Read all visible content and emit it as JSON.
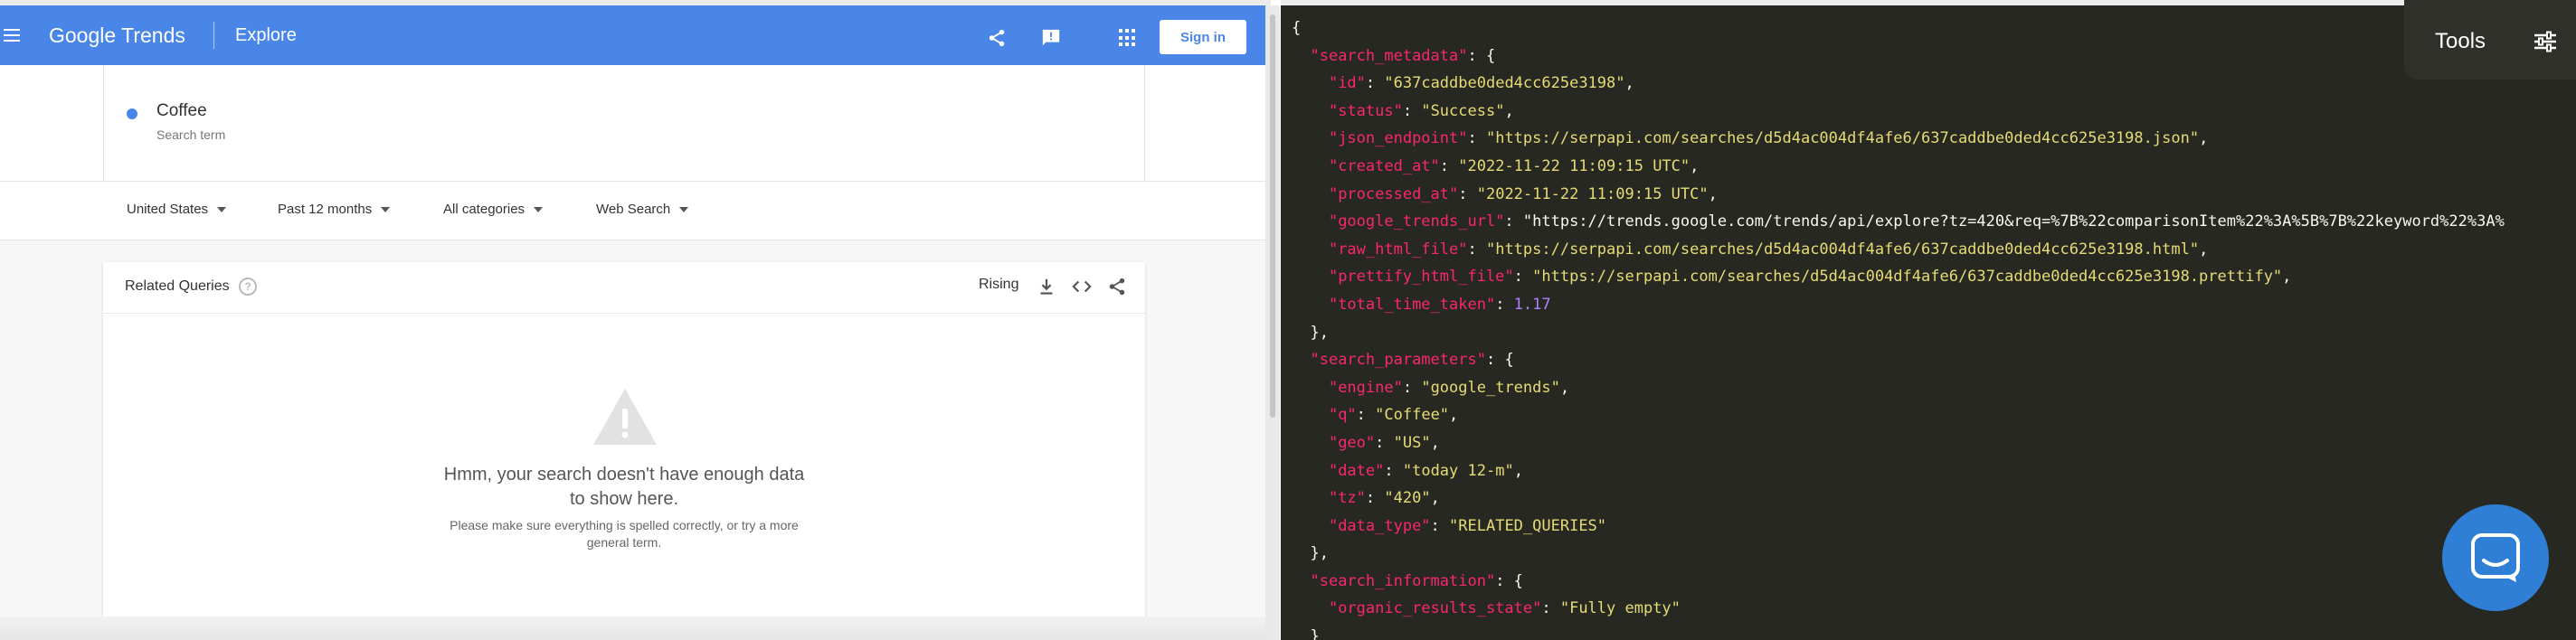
{
  "trends": {
    "logo": "Google Trends",
    "logo_parts": [
      "Google",
      "Trends"
    ],
    "section": "Explore",
    "signin_label": "Sign in",
    "search_term": "Coffee",
    "search_term_sub": "Search term",
    "filters": [
      "United States",
      "Past 12 months",
      "All categories",
      "Web Search"
    ],
    "card": {
      "title": "Related Queries",
      "help": "?",
      "mode": "Rising",
      "empty_msg": "Hmm, your search doesn't have enough data to show here.",
      "empty_hint": "Please make sure everything is spelled correctly, or try a more general term."
    },
    "accent_color": "#4a86e8"
  },
  "json_viewer": {
    "tools_label": "Tools",
    "lines": [
      "{",
      "  \"search_metadata\": {",
      "    \"id\": \"637caddbe0ded4cc625e3198\",",
      "    \"status\": \"Success\",",
      "    \"json_endpoint\": \"https://serpapi.com/searches/d5d4ac004df4afe6/637caddbe0ded4cc625e3198.json\",",
      "    \"created_at\": \"2022-11-22 11:09:15 UTC\",",
      "    \"processed_at\": \"2022-11-22 11:09:15 UTC\",",
      "    \"google_trends_url\": \"https://trends.google.com/trends/api/explore?tz=420&req=%7B%22comparisonItem%22%3A%5B%7B%22keyword%22%3A%",
      "    \"raw_html_file\": \"https://serpapi.com/searches/d5d4ac004df4afe6/637caddbe0ded4cc625e3198.html\",",
      "    \"prettify_html_file\": \"https://serpapi.com/searches/d5d4ac004df4afe6/637caddbe0ded4cc625e3198.prettify\",",
      "    \"total_time_taken\": 1.17",
      "  },",
      "  \"search_parameters\": {",
      "    \"engine\": \"google_trends\",",
      "    \"q\": \"Coffee\",",
      "    \"geo\": \"US\",",
      "    \"date\": \"today 12-m\",",
      "    \"tz\": \"420\",",
      "    \"data_type\": \"RELATED_QUERIES\"",
      "  },",
      "  \"search_information\": {",
      "    \"organic_results_state\": \"Fully empty\"",
      "  }"
    ],
    "colors": {
      "key": "#f92672",
      "string": "#e6db74",
      "number": "#ae81ff",
      "background": "#272822"
    }
  }
}
